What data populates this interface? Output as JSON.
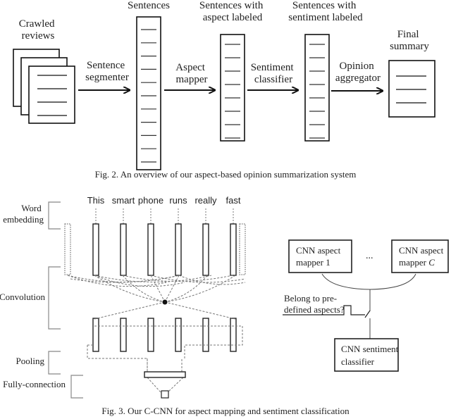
{
  "fig2": {
    "caption": "Fig. 2. An overview of our aspect-based opinion summarization system",
    "stages": {
      "crawled_reviews": [
        "Crawled",
        "reviews"
      ],
      "sentences": [
        "Sentences"
      ],
      "aspect_labeled": [
        "Sentences with",
        "aspect labeled"
      ],
      "sentiment_labeled": [
        "Sentences with",
        "sentiment labeled"
      ],
      "final_summary": [
        "Final",
        "summary"
      ]
    },
    "arrows": {
      "segmenter": [
        "Sentence",
        "segmenter"
      ],
      "aspect_mapper": [
        "Aspect",
        "mapper"
      ],
      "sentiment_classifier": [
        "Sentiment",
        "classifier"
      ],
      "opinion_aggregator": [
        "Opinion",
        "aggregator"
      ]
    }
  },
  "fig3": {
    "caption": "Fig. 3. Our C-CNN for aspect mapping and sentiment classification",
    "words": [
      "This",
      "smart",
      "phone",
      "runs",
      "really",
      "fast"
    ],
    "layers": {
      "word_embedding": [
        "Word",
        "embedding"
      ],
      "convolution": "Convolution",
      "pooling": "Pooling",
      "fully_connection": "Fully-connection"
    },
    "right": {
      "mapper_1": [
        "CNN aspect",
        "mapper 1"
      ],
      "mapper_c": [
        "CNN aspect",
        "mapper "
      ],
      "mapper_c_italic": "C",
      "ellipsis": "...",
      "question": [
        "Belong to pre-",
        "defined aspects?"
      ],
      "sentiment_classifier": [
        "CNN sentiment",
        "classifier"
      ]
    }
  }
}
